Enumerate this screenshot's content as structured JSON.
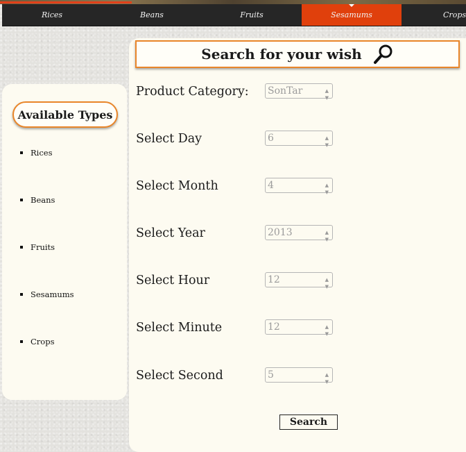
{
  "nav": {
    "items": [
      {
        "label": "Rices",
        "active": false
      },
      {
        "label": "Beans",
        "active": false
      },
      {
        "label": "Fruits",
        "active": false
      },
      {
        "label": "Sesamums",
        "active": true
      },
      {
        "label": "Crops",
        "active": false
      }
    ]
  },
  "sidebar": {
    "heading": "Available Types",
    "items": [
      "Rices",
      "Beans",
      "Fruits",
      "Sesamums",
      "Crops"
    ]
  },
  "main": {
    "title": "Search for your wish",
    "fields": [
      {
        "label": "Product Category:",
        "value": "SonTar"
      },
      {
        "label": "Select Day",
        "value": "6"
      },
      {
        "label": "Select Month",
        "value": "4"
      },
      {
        "label": "Select Year",
        "value": "2013"
      },
      {
        "label": "Select Hour",
        "value": "12"
      },
      {
        "label": "Select Minute",
        "value": "12"
      },
      {
        "label": "Select Second",
        "value": "5"
      }
    ],
    "search_label": "Search"
  },
  "colors": {
    "accent": "#e0400c",
    "border_orange": "#e9862a",
    "nav_bg": "#262626",
    "panel_bg": "#fdfbf1"
  },
  "icons": {
    "title_icon": "magnifier-icon",
    "select_icon": "chevron-down-icon"
  }
}
